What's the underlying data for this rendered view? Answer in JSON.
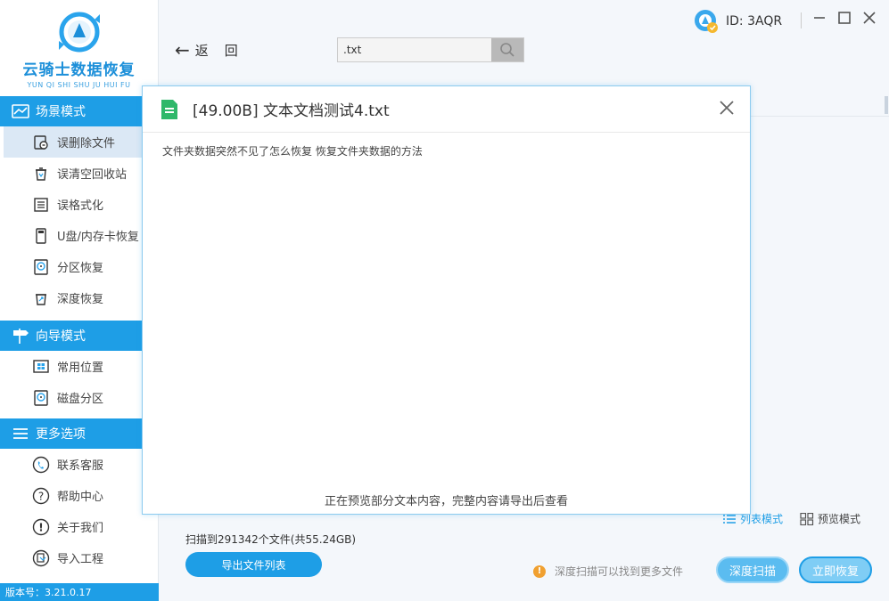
{
  "app": {
    "logo_title": "云骑士数据恢复",
    "logo_subtitle": "YUN QI SHI SHU JU HUI FU",
    "version": "版本号：3.21.0.17"
  },
  "sidebar": {
    "sections": [
      {
        "title": "场景模式",
        "icon": "scene-icon",
        "items": [
          {
            "label": "误删除文件",
            "icon": "deleted-file-icon",
            "active": true
          },
          {
            "label": "误清空回收站",
            "icon": "recycle-bin-icon"
          },
          {
            "label": "误格式化",
            "icon": "format-icon"
          },
          {
            "label": "U盘/内存卡恢复",
            "icon": "usb-icon"
          },
          {
            "label": "分区恢复",
            "icon": "partition-icon"
          },
          {
            "label": "深度恢复",
            "icon": "deep-recover-icon"
          }
        ]
      },
      {
        "title": "向导模式",
        "icon": "guide-icon",
        "items": [
          {
            "label": "常用位置",
            "icon": "windows-icon"
          },
          {
            "label": "磁盘分区",
            "icon": "disk-icon"
          }
        ]
      },
      {
        "title": "更多选项",
        "icon": "menu-icon",
        "items": [
          {
            "label": "联系客服",
            "icon": "phone-icon"
          },
          {
            "label": "帮助中心",
            "icon": "help-icon"
          },
          {
            "label": "关于我们",
            "icon": "info-icon"
          },
          {
            "label": "导入工程",
            "icon": "import-icon"
          }
        ]
      }
    ]
  },
  "topbar": {
    "back_label": "返回",
    "search_value": ".txt",
    "user_id": "ID: 3AQR"
  },
  "modal": {
    "title": "[49.00B] 文本文档测试4.txt",
    "content": "文件夹数据突然不见了怎么恢复  恢复文件夹数据的方法",
    "footer": "正在预览部分文本内容，完整内容请导出后查看"
  },
  "bottom": {
    "scan_info": "扫描到291342个文件(共55.24GB)",
    "export_label": "导出文件列表",
    "list_mode": "列表模式",
    "preview_mode": "预览模式",
    "hint": "深度扫描可以找到更多文件",
    "deep_scan": "深度扫描",
    "recover_now": "立即恢复"
  },
  "colors": {
    "accent": "#1e9ee6",
    "active_bg": "#dbe8f5",
    "warn": "#f0a030",
    "file_green": "#2fb86a"
  }
}
